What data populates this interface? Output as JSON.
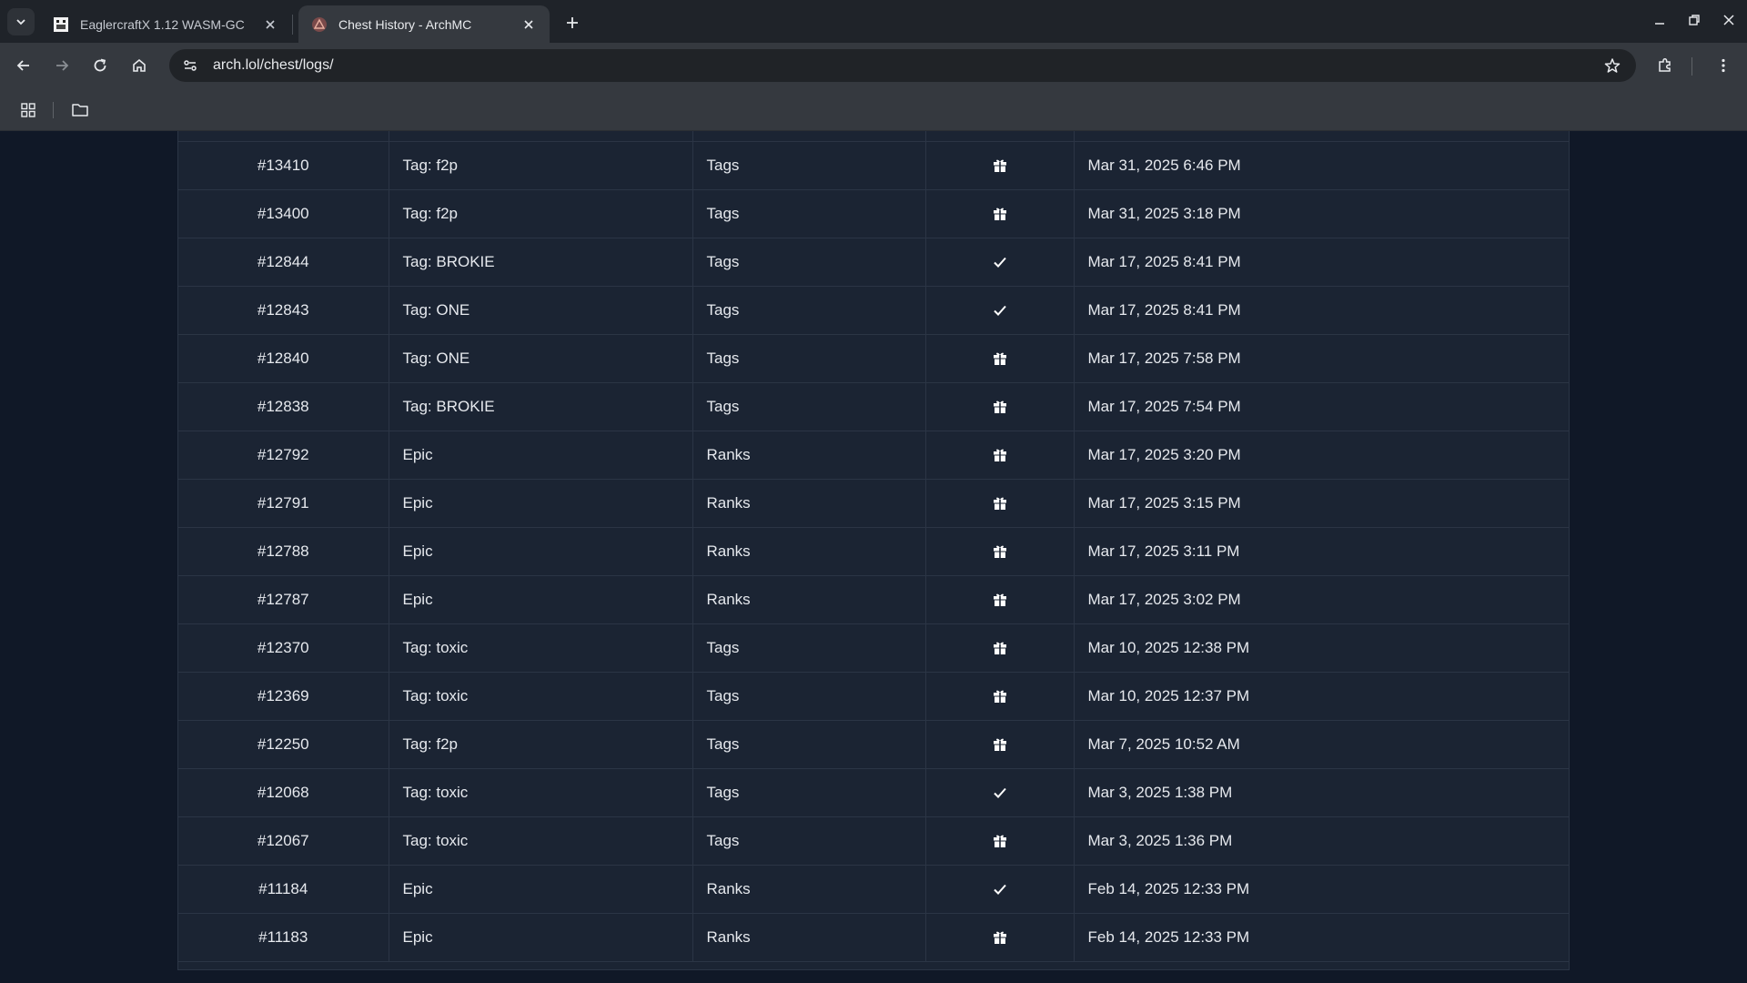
{
  "browser": {
    "tabs": [
      {
        "title": "EaglercraftX 1.12 WASM-GC",
        "active": false
      },
      {
        "title": "Chest History - ArchMC",
        "active": true
      }
    ],
    "url": "arch.lol/chest/logs/"
  },
  "table": {
    "rows": [
      {
        "id": "#13410",
        "item": "Tag: f2p",
        "category": "Tags",
        "status": "gift-icon",
        "date": "Mar 31, 2025 6:46 PM"
      },
      {
        "id": "#13400",
        "item": "Tag: f2p",
        "category": "Tags",
        "status": "gift-icon",
        "date": "Mar 31, 2025 3:18 PM"
      },
      {
        "id": "#12844",
        "item": "Tag: BROKIE",
        "category": "Tags",
        "status": "check-icon",
        "date": "Mar 17, 2025 8:41 PM"
      },
      {
        "id": "#12843",
        "item": "Tag: ONE",
        "category": "Tags",
        "status": "check-icon",
        "date": "Mar 17, 2025 8:41 PM"
      },
      {
        "id": "#12840",
        "item": "Tag: ONE",
        "category": "Tags",
        "status": "gift-icon",
        "date": "Mar 17, 2025 7:58 PM"
      },
      {
        "id": "#12838",
        "item": "Tag: BROKIE",
        "category": "Tags",
        "status": "gift-icon",
        "date": "Mar 17, 2025 7:54 PM"
      },
      {
        "id": "#12792",
        "item": "Epic",
        "category": "Ranks",
        "status": "gift-icon",
        "date": "Mar 17, 2025 3:20 PM"
      },
      {
        "id": "#12791",
        "item": "Epic",
        "category": "Ranks",
        "status": "gift-icon",
        "date": "Mar 17, 2025 3:15 PM"
      },
      {
        "id": "#12788",
        "item": "Epic",
        "category": "Ranks",
        "status": "gift-icon",
        "date": "Mar 17, 2025 3:11 PM"
      },
      {
        "id": "#12787",
        "item": "Epic",
        "category": "Ranks",
        "status": "gift-icon",
        "date": "Mar 17, 2025 3:02 PM"
      },
      {
        "id": "#12370",
        "item": "Tag: toxic",
        "category": "Tags",
        "status": "gift-icon",
        "date": "Mar 10, 2025 12:38 PM"
      },
      {
        "id": "#12369",
        "item": "Tag: toxic",
        "category": "Tags",
        "status": "gift-icon",
        "date": "Mar 10, 2025 12:37 PM"
      },
      {
        "id": "#12250",
        "item": "Tag: f2p",
        "category": "Tags",
        "status": "gift-icon",
        "date": "Mar 7, 2025 10:52 AM"
      },
      {
        "id": "#12068",
        "item": "Tag: toxic",
        "category": "Tags",
        "status": "check-icon",
        "date": "Mar 3, 2025 1:38 PM"
      },
      {
        "id": "#12067",
        "item": "Tag: toxic",
        "category": "Tags",
        "status": "gift-icon",
        "date": "Mar 3, 2025 1:36 PM"
      },
      {
        "id": "#11184",
        "item": "Epic",
        "category": "Ranks",
        "status": "check-icon",
        "date": "Feb 14, 2025 12:33 PM"
      },
      {
        "id": "#11183",
        "item": "Epic",
        "category": "Ranks",
        "status": "gift-icon",
        "date": "Feb 14, 2025 12:33 PM"
      }
    ]
  },
  "colors": {
    "chrome_bg": "#1f2329",
    "toolbar_bg": "#35393f",
    "page_bg": "#101827",
    "table_bg": "#1b2433",
    "border": "#2b3545"
  }
}
